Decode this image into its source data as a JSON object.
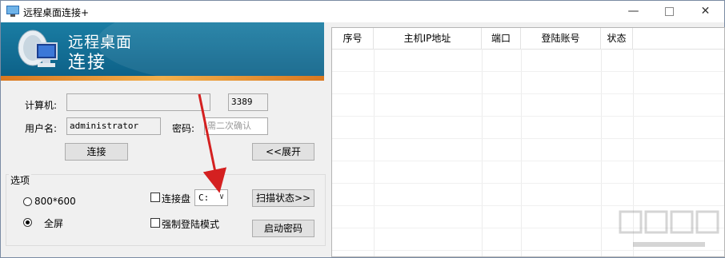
{
  "window": {
    "title": "远程桌面连接+"
  },
  "banner": {
    "line1": "远程桌面",
    "line2": "连接"
  },
  "form": {
    "computer_label": "计算机:",
    "computer_value": "",
    "port_value": "3389",
    "user_label": "用户名:",
    "user_value": "administrator",
    "password_label": "密码:",
    "password_placeholder": "需二次确认",
    "connect_label": "连接",
    "expand_label": "<<展开"
  },
  "options": {
    "group_title": "选项",
    "radio_800": "800*600",
    "radio_full": "全屏",
    "selected_mode": "全屏",
    "connect_drive_label": "连接盘",
    "connect_drive_checked": false,
    "drive_value": "C:",
    "force_login_label": "强制登陆模式",
    "force_login_checked": false,
    "scan_label": "扫描状态>>",
    "start_pwd_label": "启动密码"
  },
  "table": {
    "columns": [
      "序号",
      "主机IP地址",
      "端口",
      "登陆账号",
      "状态"
    ],
    "rows": []
  },
  "colors": {
    "annotation_arrow": "#d42020",
    "banner": "#0c5f86",
    "accent_stripe": "#f3b04c"
  }
}
